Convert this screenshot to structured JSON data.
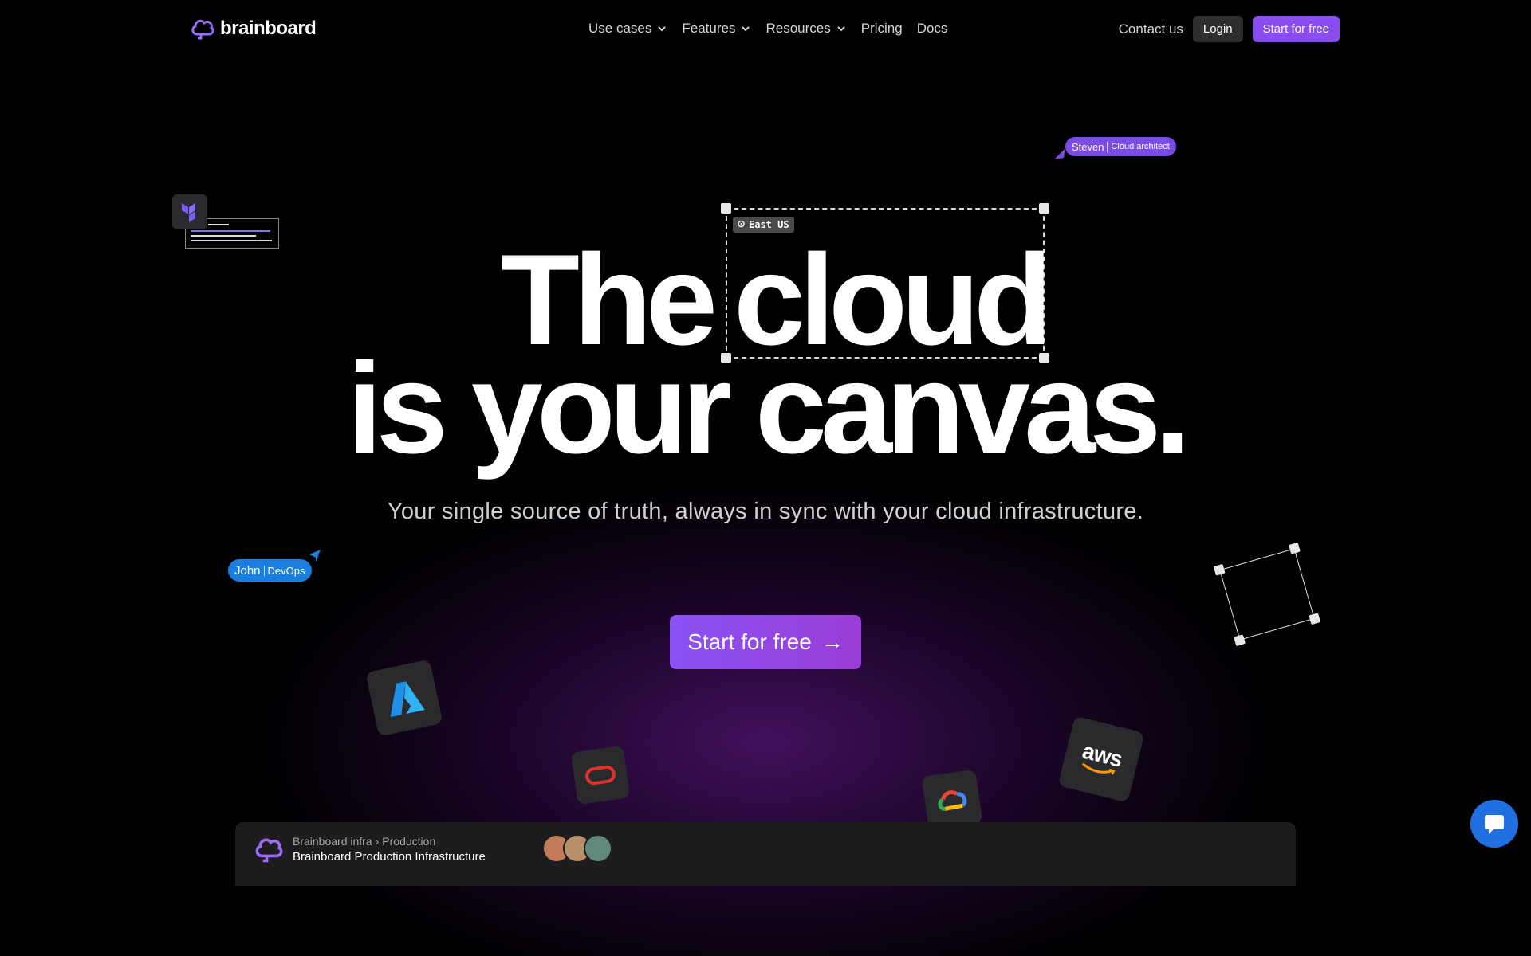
{
  "nav": {
    "logo_text": "brainboard",
    "links": [
      "Use cases",
      "Features",
      "Resources",
      "Pricing",
      "Docs"
    ],
    "contact": "Contact us",
    "login": "Login",
    "start_free": "Start for free"
  },
  "hero": {
    "line1_word1": "The",
    "line1_word2": "cloud",
    "line2": "is your canvas.",
    "region_tag": "East US",
    "subtitle": "Your single source of truth, always in sync with your cloud infrastructure.",
    "cta": "Start for free",
    "cta_arrow": "→"
  },
  "cursors": {
    "steven": {
      "name": "Steven",
      "role": "Cloud architect",
      "color": "#7b4be8"
    },
    "john": {
      "name": "John",
      "role": "DevOps",
      "color": "#1a7fe0"
    }
  },
  "cloud_icons": [
    "azure-icon",
    "oracle-icon",
    "google-cloud-icon",
    "aws-icon",
    "terraform-icon"
  ],
  "aws_label": "aws",
  "bottom_bar": {
    "crumb_root": "Brainboard infra",
    "crumb_child": "Production",
    "title": "Brainboard Production Infrastructure"
  },
  "colors": {
    "accent": "#8a4df0",
    "chat": "#1f6fe0"
  }
}
